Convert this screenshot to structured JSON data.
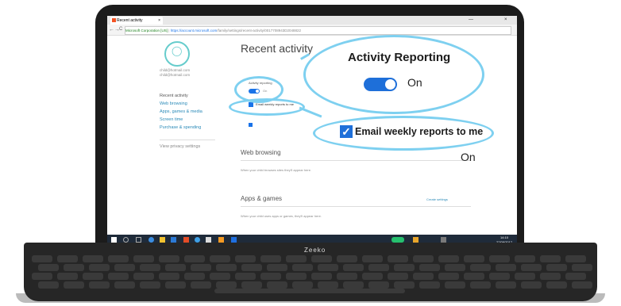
{
  "browser": {
    "tab_label": "Recent activity",
    "tab_close": "×",
    "back": "←",
    "forward": "→",
    "reload": "C",
    "secure_label": "Microsoft Corporation [US]",
    "url_host": "https://account.microsoft.com",
    "url_path": "/family/settings/recent-activity/0017708943D2048822",
    "minimize": "—",
    "close": "×"
  },
  "sidebar": {
    "name_line1": "child@hotmail.com",
    "name_line2": "child@hotmail.com",
    "items": [
      {
        "label": "Recent activity"
      },
      {
        "label": "Web browsing"
      },
      {
        "label": "Apps, games & media"
      },
      {
        "label": "Screen time"
      },
      {
        "label": "Purchase & spending"
      }
    ],
    "privacy": "View privacy settings"
  },
  "main": {
    "title": "Recent activity",
    "activity_reporting_small": "Activity reporting",
    "activity_on_small": "On",
    "email_weekly_small": "Email weekly reports to me",
    "web_browsing": "Web browsing",
    "web_browsing_note": "When your child browses sites they'll appear here.",
    "apps_games": "Apps & games",
    "apps_link": "Create settings",
    "apps_note": "When your child uses apps or games, they'll appear here."
  },
  "callouts": {
    "activity_title": "Activity Reporting",
    "activity_state": "On",
    "email_label": "Email weekly reports to me",
    "email_state": "On"
  },
  "taskbar": {
    "clock_time": "14:10",
    "clock_date": "27/09/2017"
  },
  "laptop": {
    "brand": "Zeeko"
  },
  "colors": {
    "accent": "#1e6fd9",
    "callout_ring": "#7ed0f0",
    "bezel": "#1c1c1c"
  }
}
